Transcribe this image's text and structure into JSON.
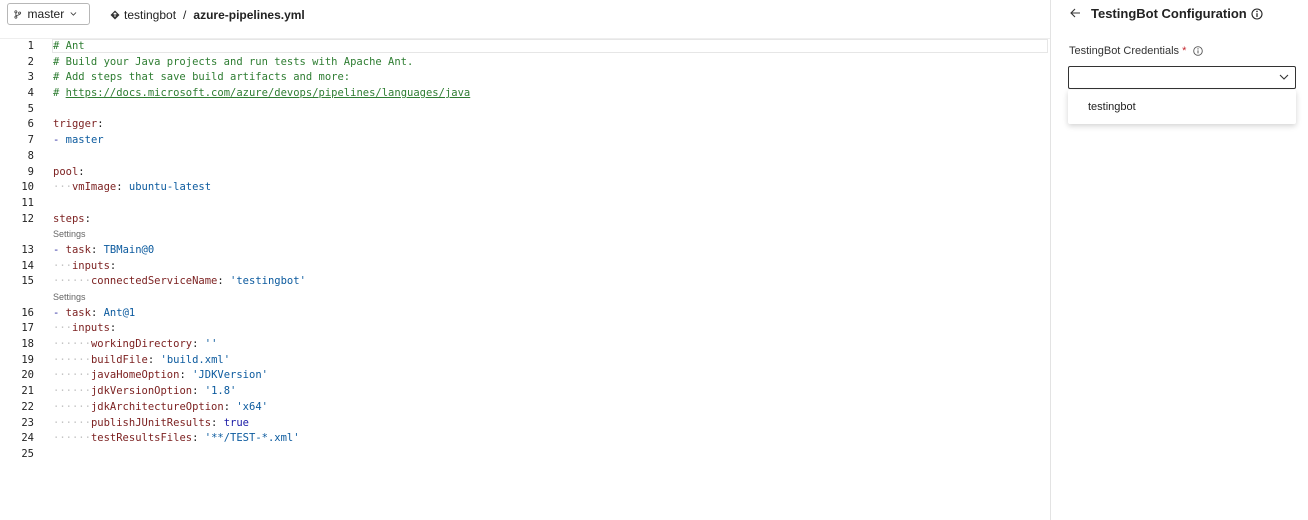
{
  "toolbar": {
    "branch": "master",
    "repo": "testingbot",
    "separator": "/",
    "file": "azure-pipelines.yml"
  },
  "editor": {
    "lines": [
      {
        "n": "1",
        "text": "# Ant",
        "cls": "cm"
      },
      {
        "n": "2",
        "text": "# Build your Java projects and run tests with Apache Ant.",
        "cls": "cm"
      },
      {
        "n": "3",
        "text": "# Add steps that save build artifacts and more:",
        "cls": "cm"
      },
      {
        "n": "4",
        "text": "https://docs.microsoft.com/azure/devops/pipelines/languages/java",
        "cls": "url",
        "prefix": "# "
      },
      {
        "n": "5",
        "text": ""
      },
      {
        "n": "6",
        "key": "trigger",
        "text": ""
      },
      {
        "n": "7",
        "dash": "- ",
        "val": "master",
        "valcls": "str"
      },
      {
        "n": "8",
        "text": ""
      },
      {
        "n": "9",
        "key": "pool",
        "text": ""
      },
      {
        "n": "10",
        "indent": 1,
        "key": "vmImage",
        "val": "ubuntu-latest",
        "valcls": "str"
      },
      {
        "n": "11",
        "text": ""
      },
      {
        "n": "12",
        "key": "steps",
        "text": ""
      },
      {
        "lens": "Settings"
      },
      {
        "n": "13",
        "dash": "- ",
        "key": "task",
        "val": "TBMain@0",
        "valcls": "str"
      },
      {
        "n": "14",
        "indent": 1,
        "key": "inputs"
      },
      {
        "n": "15",
        "indent": 2,
        "key": "connectedServiceName",
        "val": "'testingbot'",
        "valcls": "str"
      },
      {
        "lens": "Settings"
      },
      {
        "n": "16",
        "dash": "- ",
        "key": "task",
        "val": "Ant@1",
        "valcls": "str"
      },
      {
        "n": "17",
        "indent": 1,
        "key": "inputs"
      },
      {
        "n": "18",
        "indent": 2,
        "key": "workingDirectory",
        "val": "''",
        "valcls": "str"
      },
      {
        "n": "19",
        "indent": 2,
        "key": "buildFile",
        "val": "'build.xml'",
        "valcls": "str"
      },
      {
        "n": "20",
        "indent": 2,
        "key": "javaHomeOption",
        "val": "'JDKVersion'",
        "valcls": "str"
      },
      {
        "n": "21",
        "indent": 2,
        "key": "jdkVersionOption",
        "val": "'1.8'",
        "valcls": "str"
      },
      {
        "n": "22",
        "indent": 2,
        "key": "jdkArchitectureOption",
        "val": "'x64'",
        "valcls": "str"
      },
      {
        "n": "23",
        "indent": 2,
        "key": "publishJUnitResults",
        "val": "true",
        "valcls": "kw"
      },
      {
        "n": "24",
        "indent": 2,
        "key": "testResultsFiles",
        "val": "'**/TEST-*.xml'",
        "valcls": "str"
      },
      {
        "n": "25",
        "text": ""
      }
    ]
  },
  "panel": {
    "title": "TestingBot Configuration",
    "field_label": "TestingBot Credentials",
    "required_mark": "*",
    "select_value": "",
    "options": [
      "testingbot"
    ]
  },
  "icons": [
    "branch-icon",
    "repo-icon",
    "chevron-down-icon",
    "back-arrow-icon",
    "info-icon"
  ]
}
